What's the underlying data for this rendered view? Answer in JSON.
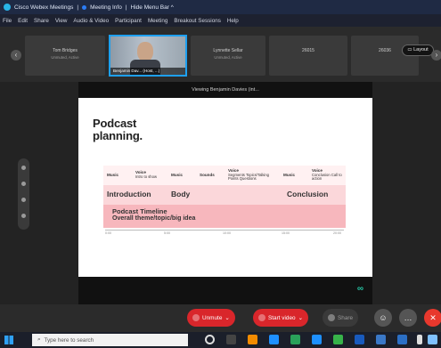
{
  "window": {
    "app_title": "Cisco Webex Meetings",
    "meeting_info": "Meeting Info",
    "hide_menu_bar": "Hide Menu Bar ^"
  },
  "menu": [
    "File",
    "Edit",
    "Share",
    "View",
    "Audio & Video",
    "Participant",
    "Meeting",
    "Breakout Sessions",
    "Help"
  ],
  "participants": [
    {
      "name": "Tom Bridges",
      "sub": "Unmuted, Active"
    },
    {
      "name": "Benjamin Dav... (Host, ...)",
      "active": true
    },
    {
      "name": "Lynnette Sellar",
      "sub": "Unmuted, Active"
    },
    {
      "name": "26015"
    },
    {
      "name": "26036"
    }
  ],
  "layout_label": "Layout",
  "viewing_text": "Viewing Benjamin Davies (int...",
  "slide": {
    "title_line1": "Podcast",
    "title_line2": "planning.",
    "row1": [
      {
        "bold": "Music",
        "sub": ""
      },
      {
        "bold": "Voice",
        "sub": "Intro to show"
      },
      {
        "bold": "Music",
        "sub": ""
      },
      {
        "bold": "Sounds",
        "sub": ""
      },
      {
        "bold": "Voice",
        "sub": "Segments Topics/Talking Points Questions"
      },
      {
        "bold": "Music",
        "sub": ""
      },
      {
        "bold": "Voice",
        "sub": "Conclusion Call to action"
      }
    ],
    "row2": [
      "Introduction",
      "Body",
      "Conclusion"
    ],
    "row3_line1": "Podcast Timeline",
    "row3_line2": "Overall theme/topic/big idea",
    "axis_ticks": [
      "0:00",
      "5:00",
      "10:00",
      "15:00",
      "20:00"
    ]
  },
  "controls": {
    "unmute": "Unmute",
    "start_video": "Start video",
    "share": "Share"
  },
  "taskbar": {
    "search_placeholder": "Type here to search"
  },
  "colors": {
    "accent": "#1ea0f0",
    "unmute": "#d9262b",
    "end": "#e8382d",
    "row1": "#fff1f2",
    "row2": "#fbd7da",
    "row3": "#f7b7bd"
  }
}
